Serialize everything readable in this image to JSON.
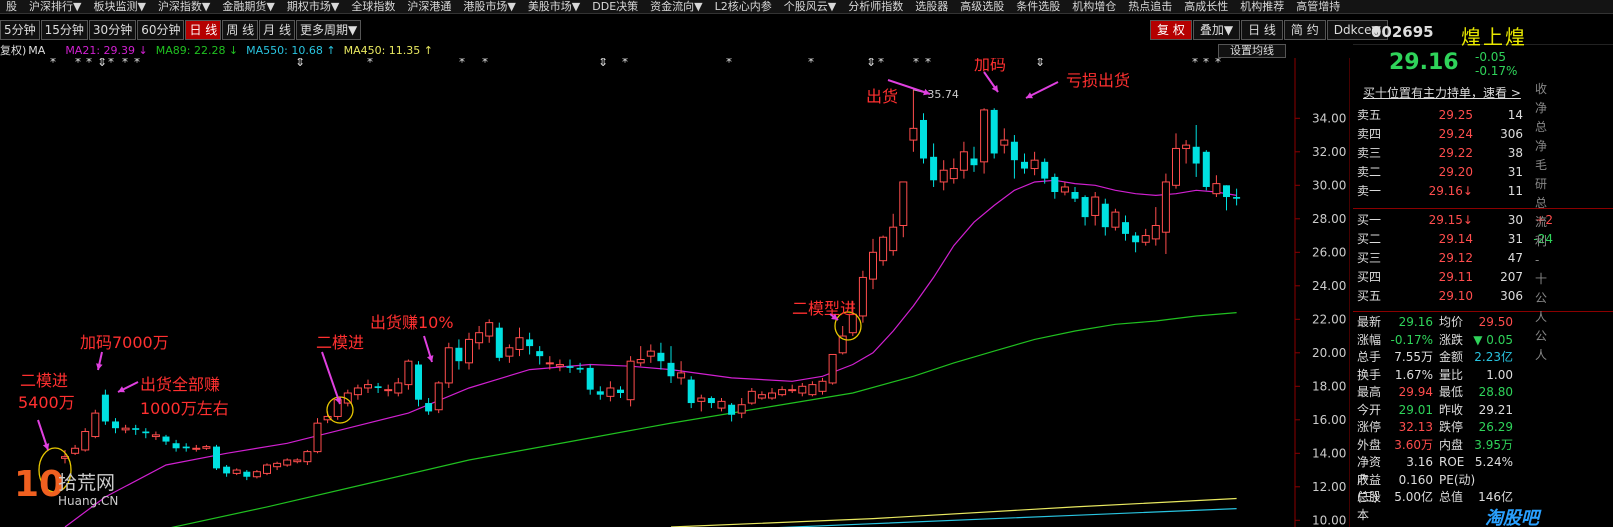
{
  "menu": [
    "股",
    "沪深排行▼",
    "板块监测▼",
    "沪深指数▼",
    "金融期货▼",
    "期权市场▼",
    "全球指数",
    "沪深港通",
    "港股市场▼",
    "美股市场▼",
    "DDE决策",
    "资金流向▼",
    "L2核心内参",
    "个股风云▼",
    "分析师指数",
    "选股器",
    "高级选股",
    "条件选股",
    "机构增仓",
    "热点追击",
    "高成长性",
    "机构推荐",
    "高管增持"
  ],
  "periods": [
    "5分钟",
    "15分钟",
    "30分钟",
    "60分钟",
    "日 线",
    "周 线",
    "月 线",
    "更多周期▼"
  ],
  "active_period": "日 线",
  "toolbar": [
    "复 权",
    "叠加▼",
    "日 线",
    "简 约",
    "Ddkce▼"
  ],
  "ma_legend": {
    "prefix": "复权)",
    "ma_label": "MA",
    "ma21": "MA21: 29.39 ↓",
    "ma89": "MA89: 22.28 ↓",
    "ma550": "MA550: 10.68 ↑",
    "ma450": "MA450: 11.35 ↑",
    "setting": "设置均线"
  },
  "colors": {
    "ma21": "#d020d0",
    "ma89": "#20c020",
    "ma550": "#29c4e0",
    "ma450": "#e8e860",
    "up": "#ff4d4d",
    "down": "#00e0e0",
    "annot": "#ff3030"
  },
  "chart_data": {
    "type": "candlestick",
    "ylim": [
      9.6,
      37.6
    ],
    "yticks": [
      "34.00",
      "32.00",
      "30.00",
      "28.00",
      "26.00",
      "24.00",
      "22.00",
      "20.00",
      "18.00",
      "16.00",
      "14.00",
      "12.00",
      "10.00"
    ],
    "ytick_values": [
      34,
      32,
      30,
      28,
      26,
      24,
      22,
      20,
      18,
      16,
      14,
      12,
      10
    ],
    "high_label": "35.74",
    "candles": [
      [
        13.7,
        13.8,
        13.4,
        14.2
      ],
      [
        14.0,
        14.3,
        13.9,
        14.5
      ],
      [
        14.2,
        15.3,
        14.1,
        15.5
      ],
      [
        15.0,
        16.4,
        14.9,
        16.6
      ],
      [
        17.5,
        15.9,
        15.7,
        17.8
      ],
      [
        15.9,
        15.5,
        15.2,
        16.1
      ],
      [
        15.4,
        15.5,
        15.2,
        15.7
      ],
      [
        15.5,
        15.4,
        15.1,
        15.7
      ],
      [
        15.3,
        15.2,
        14.9,
        15.5
      ],
      [
        15.0,
        15.1,
        14.8,
        15.3
      ],
      [
        15.0,
        14.7,
        14.5,
        15.1
      ],
      [
        14.6,
        14.3,
        14.1,
        14.8
      ],
      [
        14.4,
        14.3,
        14.1,
        14.6
      ],
      [
        14.3,
        14.3,
        14.1,
        14.5
      ],
      [
        14.3,
        14.4,
        14.2,
        14.5
      ],
      [
        14.4,
        13.1,
        13.0,
        14.5
      ],
      [
        13.2,
        12.8,
        12.6,
        13.3
      ],
      [
        12.8,
        13.0,
        12.7,
        13.1
      ],
      [
        12.9,
        12.6,
        12.4,
        13.0
      ],
      [
        12.6,
        12.9,
        12.5,
        13.0
      ],
      [
        12.8,
        13.3,
        12.7,
        13.4
      ],
      [
        13.2,
        13.4,
        13.0,
        13.5
      ],
      [
        13.3,
        13.6,
        13.2,
        13.7
      ],
      [
        13.5,
        13.6,
        13.4,
        13.7
      ],
      [
        13.5,
        14.1,
        13.3,
        14.2
      ],
      [
        14.1,
        15.8,
        14.0,
        16.1
      ],
      [
        16.0,
        16.2,
        15.8,
        16.5
      ],
      [
        16.2,
        17.2,
        16.0,
        17.4
      ],
      [
        17.0,
        17.6,
        16.8,
        17.8
      ],
      [
        17.5,
        17.9,
        17.2,
        18.1
      ],
      [
        17.9,
        18.1,
        17.6,
        18.4
      ],
      [
        18.0,
        17.9,
        17.6,
        18.2
      ],
      [
        17.8,
        17.8,
        17.4,
        18.1
      ],
      [
        17.6,
        18.2,
        17.4,
        18.5
      ],
      [
        18.1,
        19.5,
        17.8,
        19.6
      ],
      [
        19.3,
        17.2,
        16.8,
        19.5
      ],
      [
        17.0,
        16.5,
        16.3,
        17.3
      ],
      [
        16.6,
        18.2,
        16.4,
        18.3
      ],
      [
        18.2,
        20.3,
        17.9,
        20.6
      ],
      [
        20.3,
        19.5,
        19.0,
        20.8
      ],
      [
        19.4,
        20.8,
        19.0,
        21.2
      ],
      [
        20.6,
        21.2,
        20.2,
        21.6
      ],
      [
        21.0,
        21.8,
        20.6,
        22.0
      ],
      [
        21.5,
        19.7,
        19.5,
        21.8
      ],
      [
        19.8,
        20.3,
        19.4,
        20.5
      ],
      [
        20.2,
        20.9,
        19.8,
        21.5
      ],
      [
        20.8,
        20.4,
        19.9,
        21.2
      ],
      [
        20.1,
        19.8,
        19.3,
        20.4
      ],
      [
        19.4,
        19.4,
        19.0,
        19.8
      ],
      [
        19.2,
        19.3,
        18.9,
        19.6
      ],
      [
        19.2,
        19.1,
        18.8,
        19.6
      ],
      [
        19.1,
        19.0,
        18.8,
        19.4
      ],
      [
        19.1,
        17.8,
        17.5,
        19.3
      ],
      [
        17.7,
        17.5,
        17.2,
        18.0
      ],
      [
        17.4,
        17.9,
        17.1,
        18.3
      ],
      [
        17.8,
        17.6,
        17.3,
        18.0
      ],
      [
        17.2,
        19.5,
        16.8,
        19.8
      ],
      [
        19.4,
        19.6,
        19.2,
        20.4
      ],
      [
        19.8,
        20.1,
        19.4,
        20.5
      ],
      [
        20.0,
        19.5,
        19.0,
        20.6
      ],
      [
        19.4,
        18.6,
        18.2,
        20.4
      ],
      [
        18.5,
        18.8,
        18.1,
        19.5
      ],
      [
        18.4,
        17.0,
        16.7,
        18.6
      ],
      [
        17.1,
        17.3,
        16.5,
        17.5
      ],
      [
        17.3,
        17.0,
        16.7,
        17.4
      ],
      [
        16.7,
        17.1,
        16.5,
        17.3
      ],
      [
        16.9,
        16.3,
        15.9,
        17.0
      ],
      [
        16.4,
        16.9,
        16.1,
        17.3
      ],
      [
        17.0,
        17.7,
        16.9,
        17.9
      ],
      [
        17.3,
        17.5,
        17.2,
        17.7
      ],
      [
        17.3,
        17.6,
        17.2,
        17.9
      ],
      [
        17.5,
        17.8,
        17.4,
        18.0
      ],
      [
        17.8,
        17.8,
        17.6,
        18.1
      ],
      [
        17.6,
        18.0,
        17.4,
        18.2
      ],
      [
        17.5,
        18.1,
        17.4,
        18.3
      ],
      [
        17.7,
        18.3,
        17.5,
        18.5
      ],
      [
        18.2,
        19.9,
        18.1,
        19.9
      ],
      [
        20.0,
        21.0,
        19.9,
        21.6
      ],
      [
        21.2,
        22.3,
        21.0,
        23.1
      ],
      [
        22.2,
        24.5,
        21.8,
        24.9
      ],
      [
        24.4,
        26.0,
        23.8,
        26.8
      ],
      [
        25.5,
        26.9,
        25.2,
        27.0
      ],
      [
        26.1,
        27.5,
        25.8,
        28.3
      ],
      [
        27.6,
        30.2,
        26.9,
        30.2
      ],
      [
        32.7,
        33.4,
        32.0,
        35.7
      ],
      [
        33.9,
        31.6,
        31.3,
        34.3
      ],
      [
        31.7,
        30.3,
        29.9,
        32.5
      ],
      [
        30.2,
        30.9,
        29.7,
        31.5
      ],
      [
        30.4,
        31.0,
        30.1,
        31.6
      ],
      [
        30.9,
        32.0,
        30.4,
        32.6
      ],
      [
        31.6,
        31.2,
        30.8,
        32.3
      ],
      [
        31.4,
        34.5,
        30.7,
        34.6
      ],
      [
        34.5,
        31.9,
        31.6,
        34.6
      ],
      [
        32.4,
        32.7,
        31.9,
        33.4
      ],
      [
        32.6,
        31.5,
        30.4,
        33.0
      ],
      [
        31.4,
        31.0,
        30.7,
        31.9
      ],
      [
        31.0,
        31.5,
        30.6,
        32.0
      ],
      [
        31.4,
        30.4,
        30.1,
        31.6
      ],
      [
        30.5,
        29.6,
        29.2,
        30.7
      ],
      [
        29.6,
        29.9,
        29.4,
        30.2
      ],
      [
        29.6,
        29.2,
        29.0,
        29.9
      ],
      [
        29.3,
        28.1,
        27.6,
        29.4
      ],
      [
        28.2,
        29.3,
        27.6,
        29.6
      ],
      [
        28.9,
        27.5,
        27.0,
        29.2
      ],
      [
        27.5,
        28.4,
        27.3,
        28.6
      ],
      [
        27.8,
        27.1,
        26.7,
        28.2
      ],
      [
        27.0,
        26.6,
        26.0,
        27.2
      ],
      [
        26.6,
        27.0,
        26.4,
        27.4
      ],
      [
        26.8,
        27.6,
        26.4,
        28.7
      ],
      [
        27.2,
        30.2,
        25.9,
        30.7
      ],
      [
        30.0,
        32.2,
        29.8,
        33.1
      ],
      [
        32.2,
        32.4,
        31.3,
        32.7
      ],
      [
        32.3,
        31.3,
        30.5,
        33.6
      ],
      [
        32.0,
        29.9,
        29.7,
        32.1
      ],
      [
        29.5,
        30.1,
        29.3,
        30.6
      ],
      [
        30.0,
        29.3,
        28.5,
        30.0
      ],
      [
        29.3,
        29.2,
        28.8,
        29.8
      ]
    ],
    "series": [
      {
        "name": "MA21",
        "points": [
          [
            0,
            9.6
          ],
          [
            4,
            11.4
          ],
          [
            10,
            13.3
          ],
          [
            16,
            14.0
          ],
          [
            22,
            14.6
          ],
          [
            28,
            15.5
          ],
          [
            34,
            16.4
          ],
          [
            40,
            17.9
          ],
          [
            46,
            19.0
          ],
          [
            52,
            19.3
          ],
          [
            56,
            19.2
          ],
          [
            60,
            19.0
          ],
          [
            66,
            18.5
          ],
          [
            72,
            18.3
          ],
          [
            75,
            18.6
          ],
          [
            78,
            19.3
          ],
          [
            80,
            20.0
          ],
          [
            82,
            21.3
          ],
          [
            84,
            22.8
          ],
          [
            86,
            24.5
          ],
          [
            88,
            26.4
          ],
          [
            90,
            27.8
          ],
          [
            92,
            28.8
          ],
          [
            94,
            29.7
          ],
          [
            96,
            30.2
          ],
          [
            98,
            30.3
          ],
          [
            100,
            30.1
          ],
          [
            102,
            30.0
          ],
          [
            104,
            29.7
          ],
          [
            106,
            29.5
          ],
          [
            108,
            29.4
          ],
          [
            110,
            29.5
          ],
          [
            112,
            29.7
          ],
          [
            114,
            29.6
          ],
          [
            116,
            29.4
          ]
        ]
      },
      {
        "name": "MA89",
        "points": [
          [
            0,
            8.4
          ],
          [
            10,
            9.5
          ],
          [
            20,
            10.8
          ],
          [
            30,
            12.2
          ],
          [
            40,
            13.6
          ],
          [
            50,
            14.7
          ],
          [
            60,
            15.8
          ],
          [
            70,
            16.8
          ],
          [
            78,
            17.6
          ],
          [
            84,
            18.6
          ],
          [
            88,
            19.4
          ],
          [
            92,
            20.1
          ],
          [
            96,
            20.8
          ],
          [
            100,
            21.3
          ],
          [
            104,
            21.7
          ],
          [
            108,
            21.9
          ],
          [
            112,
            22.2
          ],
          [
            116,
            22.4
          ]
        ]
      },
      {
        "name": "MA450",
        "points": [
          [
            60,
            9.6
          ],
          [
            80,
            10.1
          ],
          [
            100,
            10.8
          ],
          [
            116,
            11.3
          ]
        ]
      },
      {
        "name": "MA550",
        "points": [
          [
            60,
            9.3
          ],
          [
            80,
            9.8
          ],
          [
            100,
            10.3
          ],
          [
            116,
            10.7
          ]
        ]
      }
    ]
  },
  "annotations": [
    "二模进",
    "5400万",
    "加码7000万",
    "出货全部赚",
    "1000万左右",
    "二模进",
    "出货赚10%",
    "二模型进",
    "出货",
    "加码",
    "亏损出货"
  ],
  "stars": [
    "*",
    "*",
    "*",
    "*",
    "*",
    "*",
    "*",
    "*",
    "*",
    "*",
    "*",
    "*",
    "*",
    "*",
    "*",
    "*",
    "*",
    "*"
  ],
  "quote": {
    "code": "002695",
    "name": "煌上煌",
    "price": "29.16",
    "change": "-0.05",
    "change_pct": "-0.17%",
    "link": "买十位置有主力持单，速看 >",
    "sell": [
      {
        "label": "卖五",
        "price": "29.25",
        "vol": "14",
        "d": ""
      },
      {
        "label": "卖四",
        "price": "29.24",
        "vol": "306",
        "d": ""
      },
      {
        "label": "卖三",
        "price": "29.22",
        "vol": "38",
        "d": ""
      },
      {
        "label": "卖二",
        "price": "29.20",
        "vol": "31",
        "d": ""
      },
      {
        "label": "卖一",
        "price": "29.16↓",
        "vol": "11",
        "d": ""
      }
    ],
    "buy": [
      {
        "label": "买一",
        "price": "29.15↓",
        "vol": "30",
        "d": "+2"
      },
      {
        "label": "买二",
        "price": "29.14",
        "vol": "31",
        "d": "-24"
      },
      {
        "label": "买三",
        "price": "29.12",
        "vol": "47",
        "d": ""
      },
      {
        "label": "买四",
        "price": "29.11",
        "vol": "207",
        "d": ""
      },
      {
        "label": "买五",
        "price": "29.10",
        "vol": "306",
        "d": ""
      }
    ],
    "stats": [
      {
        "k1": "最新",
        "v1": "29.16",
        "c1": "green",
        "k2": "均价",
        "v2": "29.50",
        "c2": "red"
      },
      {
        "k1": "涨幅",
        "v1": "-0.17%",
        "c1": "green",
        "k2": "涨跌",
        "v2": "▼ 0.05",
        "c2": "green"
      },
      {
        "k1": "总手",
        "v1": "7.55万",
        "c1": "wht",
        "k2": "金额",
        "v2": "2.23亿",
        "c2": "cyan"
      },
      {
        "k1": "换手",
        "v1": "1.67%",
        "c1": "wht",
        "k2": "量比",
        "v2": "1.00",
        "c2": "wht"
      },
      {
        "k1": "最高",
        "v1": "29.94",
        "c1": "red",
        "k2": "最低",
        "v2": "28.80",
        "c2": "green"
      },
      {
        "k1": "今开",
        "v1": "29.01",
        "c1": "green",
        "k2": "昨收",
        "v2": "29.21",
        "c2": "wht"
      },
      {
        "k1": "涨停",
        "v1": "32.13",
        "c1": "red",
        "k2": "跌停",
        "v2": "26.29",
        "c2": "green"
      },
      {
        "k1": "外盘",
        "v1": "3.60万",
        "c1": "red",
        "k2": "内盘",
        "v2": "3.95万",
        "c2": "green"
      },
      {
        "k1": "净资产",
        "v1": "3.16",
        "c1": "wht",
        "k2": "ROE",
        "v2": "5.24%",
        "c2": "wht"
      },
      {
        "k1": "收益(三)",
        "v1": "0.160",
        "c1": "wht",
        "k2": "PE(动)",
        "v2": "",
        "c2": "wht"
      },
      {
        "k1": "总股本",
        "v1": "5.00亿",
        "c1": "wht",
        "k2": "总值",
        "v2": "146亿",
        "c2": "wht"
      }
    ],
    "side": [
      "收",
      "净",
      "总",
      "净",
      "毛",
      "研",
      "总",
      "流",
      "利",
      "-",
      "十",
      "公",
      "人",
      "公",
      "人"
    ]
  },
  "watermark": {
    "num": "10",
    "cn": "拾荒网",
    "url": "Huang.CN",
    "right": "淘股吧"
  }
}
